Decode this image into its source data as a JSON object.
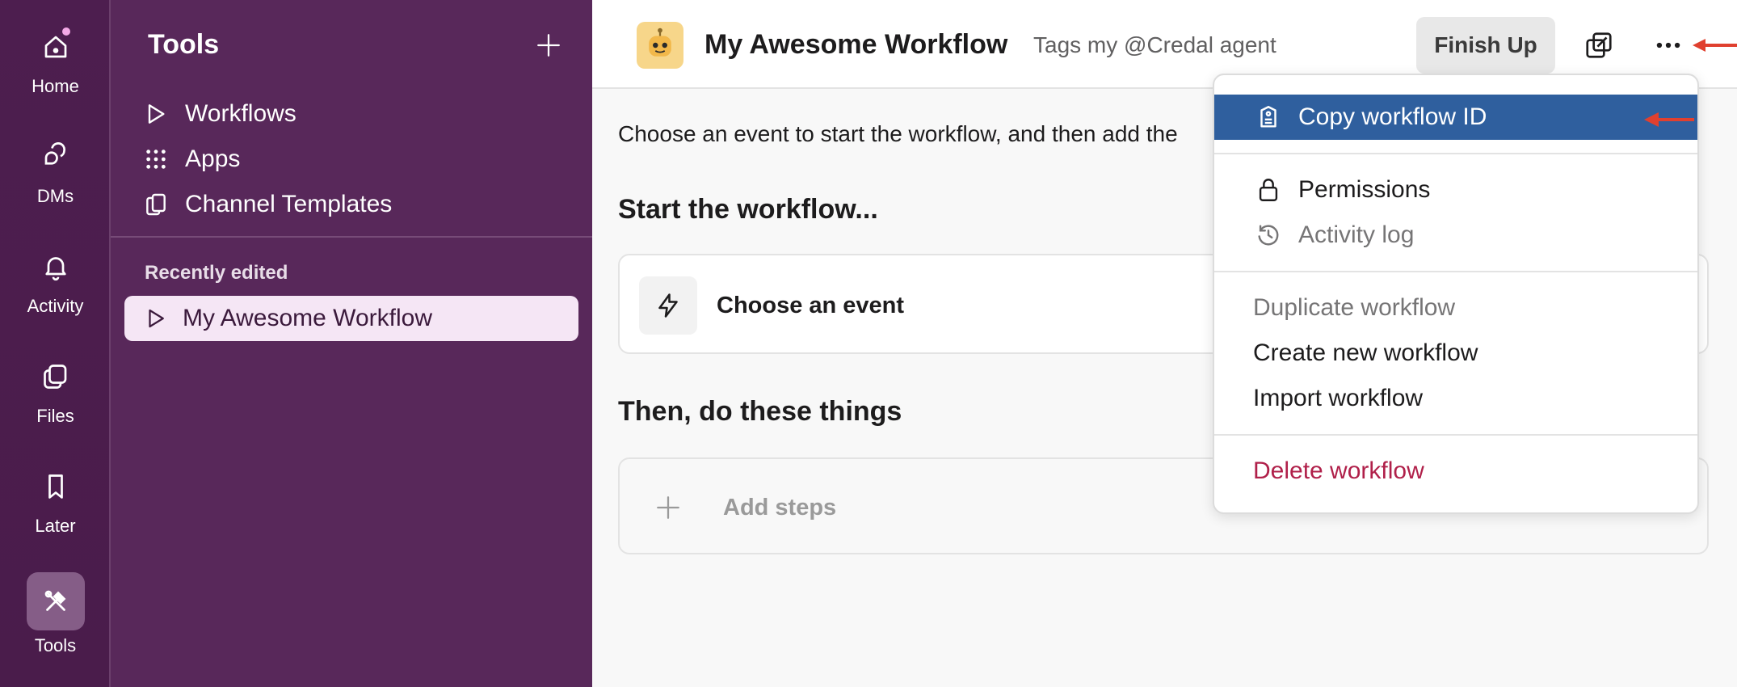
{
  "rail": {
    "items": [
      {
        "label": "Home"
      },
      {
        "label": "DMs"
      },
      {
        "label": "Activity"
      },
      {
        "label": "Files"
      },
      {
        "label": "Later"
      },
      {
        "label": "Tools"
      }
    ]
  },
  "sidebar": {
    "title": "Tools",
    "nav": [
      {
        "label": "Workflows",
        "icon": "play-icon"
      },
      {
        "label": "Apps",
        "icon": "grid-dots-icon"
      },
      {
        "label": "Channel Templates",
        "icon": "copy-icon"
      }
    ],
    "section_label": "Recently edited",
    "recent": [
      {
        "label": "My Awesome Workflow"
      }
    ]
  },
  "header": {
    "title": "My Awesome Workflow",
    "subtitle": "Tags my @Credal agent",
    "finish_label": "Finish Up"
  },
  "main": {
    "intro": "Choose an event to start the workflow, and then add the",
    "start_heading": "Start the workflow...",
    "event_label": "Choose an event",
    "then_heading": "Then, do these things",
    "steps_label": "Add steps"
  },
  "menu": {
    "copy_id": "Copy workflow ID",
    "permissions": "Permissions",
    "activity_log": "Activity log",
    "duplicate": "Duplicate workflow",
    "create_new": "Create new workflow",
    "import": "Import workflow",
    "delete": "Delete workflow"
  },
  "colors": {
    "rail_bg": "#4a1d4c",
    "sidebar_bg": "#58285a",
    "menu_highlight": "#2f5f9e",
    "danger": "#b0204a",
    "annotation_arrow": "#e0402f"
  }
}
